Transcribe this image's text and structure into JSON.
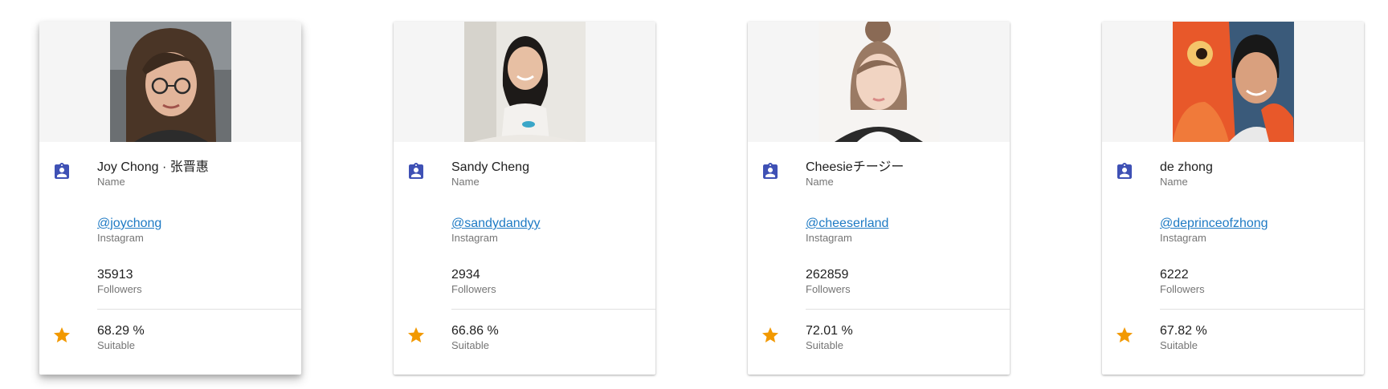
{
  "colors": {
    "icon_blue": "#3f51b5",
    "star_orange": "#f29900",
    "link": "#1e7ac4"
  },
  "cards": [
    {
      "name": "Joy Chong · 张晋惠",
      "name_label": "Name",
      "handle": "@joychong",
      "handle_label": "Instagram",
      "followers": "35913",
      "followers_label": "Followers",
      "score": "68.29 %",
      "score_label": "Suitable"
    },
    {
      "name": "Sandy Cheng",
      "name_label": "Name",
      "handle": "@sandydandyy",
      "handle_label": "Instagram",
      "followers": "2934",
      "followers_label": "Followers",
      "score": "66.86 %",
      "score_label": "Suitable"
    },
    {
      "name": "Cheesieチージー",
      "name_label": "Name",
      "handle": "@cheeserland",
      "handle_label": "Instagram",
      "followers": "262859",
      "followers_label": "Followers",
      "score": "72.01 %",
      "score_label": "Suitable"
    },
    {
      "name": "de zhong",
      "name_label": "Name",
      "handle": "@deprinceofzhong",
      "handle_label": "Instagram",
      "followers": "6222",
      "followers_label": "Followers",
      "score": "67.82 %",
      "score_label": "Suitable"
    }
  ],
  "icons": {
    "name_icon": "contact-badge-icon",
    "score_icon": "star-icon"
  }
}
